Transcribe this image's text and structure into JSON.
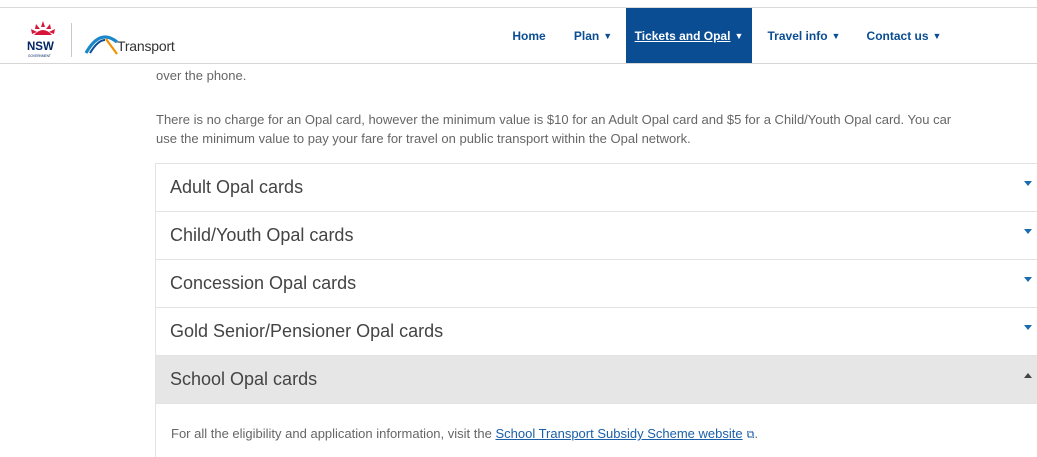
{
  "header": {
    "logo_text": "Transport",
    "nav": [
      {
        "label": "Home",
        "caret": false,
        "active": false
      },
      {
        "label": "Plan",
        "caret": true,
        "active": false
      },
      {
        "label": "Tickets and Opal",
        "caret": true,
        "active": true
      },
      {
        "label": "Travel info",
        "caret": true,
        "active": false
      },
      {
        "label": "Contact us",
        "caret": true,
        "active": false
      }
    ]
  },
  "content": {
    "intro_fragment": "over the phone.",
    "opal_paragraph_line1": "There is no charge for an Opal card, however the minimum value is $10 for an Adult Opal card and $5 for a Child/Youth Opal card. You car",
    "opal_paragraph_line2": "use the minimum value to pay your fare for travel on public transport within the Opal network."
  },
  "accordion": {
    "items": [
      {
        "title": "Adult Opal cards",
        "open": false
      },
      {
        "title": "Child/Youth Opal cards",
        "open": false
      },
      {
        "title": "Concession Opal cards",
        "open": false
      },
      {
        "title": "Gold Senior/Pensioner Opal cards",
        "open": false
      },
      {
        "title": "School Opal cards",
        "open": true
      }
    ],
    "school_panel": {
      "text_before": "For all the eligibility and application information, visit the ",
      "link_text": "School Transport Subsidy Scheme website",
      "text_after": "."
    }
  },
  "colors": {
    "nav_blue": "#0a4d92",
    "accent_blue": "#1b6bb0",
    "nsw_red": "#d7153a",
    "open_row_bg": "#e6e6e6"
  }
}
